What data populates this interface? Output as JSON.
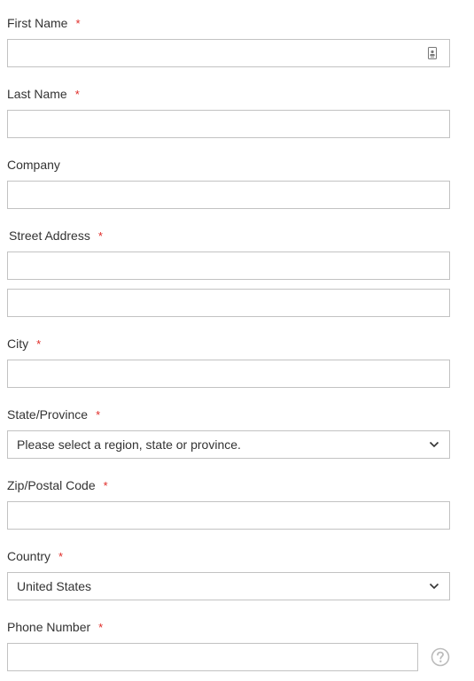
{
  "form": {
    "first_name": {
      "label": "First Name",
      "required": "*",
      "value": ""
    },
    "last_name": {
      "label": "Last Name",
      "required": "*",
      "value": ""
    },
    "company": {
      "label": "Company",
      "value": ""
    },
    "street": {
      "label": "Street Address",
      "required": "*",
      "line1": "",
      "line2": ""
    },
    "city": {
      "label": "City",
      "required": "*",
      "value": ""
    },
    "region": {
      "label": "State/Province",
      "required": "*",
      "selected": "Please select a region, state or province."
    },
    "postcode": {
      "label": "Zip/Postal Code",
      "required": "*",
      "value": ""
    },
    "country": {
      "label": "Country",
      "required": "*",
      "selected": "United States"
    },
    "phone": {
      "label": "Phone Number",
      "required": "*",
      "value": ""
    }
  },
  "colors": {
    "required": "#e02b27",
    "border": "#c2c2c2",
    "text": "#333333"
  },
  "icons": {
    "autofill": "contact-card-icon",
    "select": "chevron-down-icon",
    "help": "question-circle-icon"
  }
}
